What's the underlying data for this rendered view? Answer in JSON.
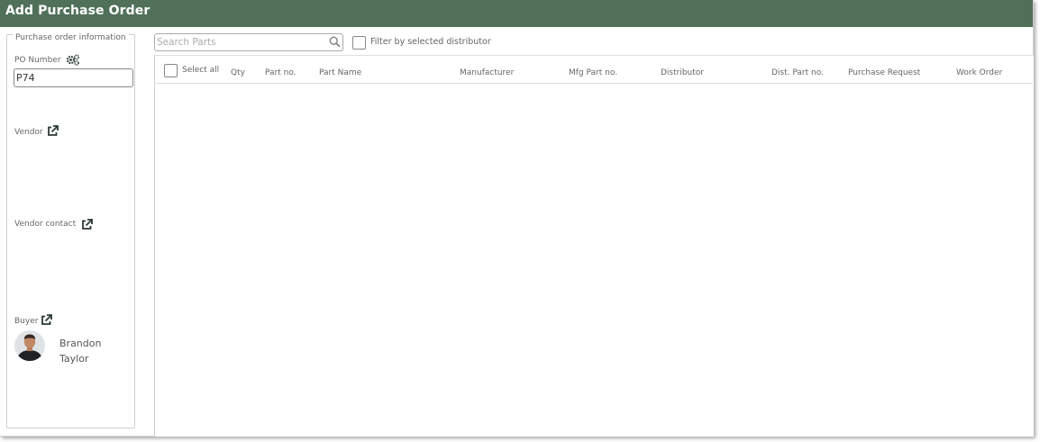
{
  "window": {
    "title": "Add Purchase Order"
  },
  "po_info": {
    "legend": "Purchase order information",
    "po_number_label": "PO Number",
    "po_number_value": "P74",
    "vendor_label": "Vendor",
    "vendor_contact_label": "Vendor contact",
    "buyer_label": "Buyer",
    "buyer_first_name": "Brandon",
    "buyer_last_name": "Taylor"
  },
  "parts": {
    "search_placeholder": "Search Parts",
    "filter_label": "Filter by selected distributor",
    "select_all_label": "Select all",
    "columns": [
      "Qty",
      "Part no.",
      "Part Name",
      "Manufacturer",
      "Mfg Part no.",
      "Distributor",
      "Dist. Part no.",
      "Purchase Request",
      "Work Order"
    ],
    "rows": []
  },
  "colors": {
    "titlebar": "#50705a",
    "title_text": "#ffffff",
    "icon": "#2b3a35"
  },
  "icons": {
    "po_number": "settings-gears-icon",
    "vendor": "external-link-icon",
    "vendor_contact": "external-link-icon",
    "buyer": "external-link-icon",
    "search": "search-icon"
  }
}
